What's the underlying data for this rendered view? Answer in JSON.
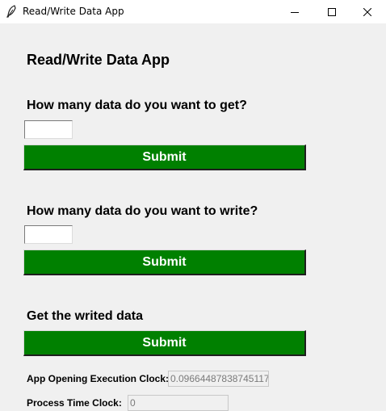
{
  "window": {
    "title": "Read/Write Data App",
    "icon": "feather-icon"
  },
  "app": {
    "heading": "Read/Write Data App",
    "get_section": {
      "label": "How many data do you want to get?",
      "input_value": "",
      "button_label": "Submit"
    },
    "write_section": {
      "label": "How many data do you want to write?",
      "input_value": "",
      "button_label": "Submit"
    },
    "written_section": {
      "label": "Get the writed data",
      "button_label": "Submit"
    },
    "clocks": {
      "opening_label": "App Opening Execution Clock:",
      "opening_value": "0.09664487838745117",
      "process_label": "Process Time Clock:",
      "process_value": "0"
    }
  },
  "colors": {
    "button_bg": "#008000",
    "button_text": "#ffffff",
    "window_bg": "#f0f0f0"
  }
}
